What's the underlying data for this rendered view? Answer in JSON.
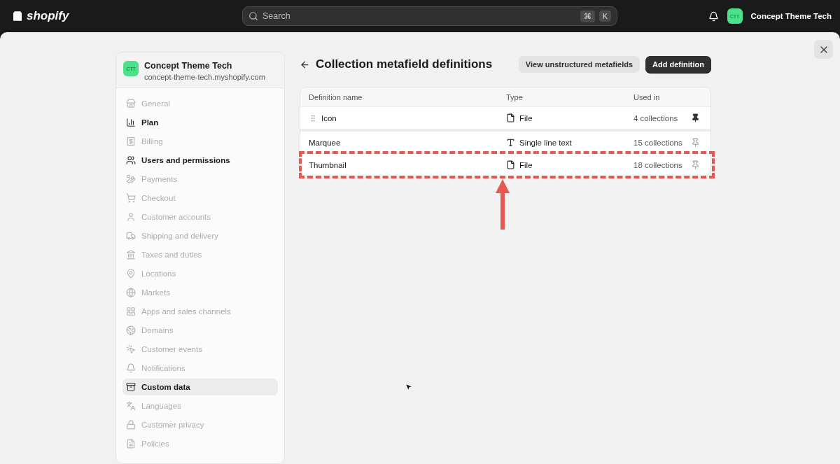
{
  "topbar": {
    "logo": "shopify",
    "search": {
      "placeholder": "Search",
      "shortcut": [
        "⌘",
        "K"
      ]
    },
    "store": {
      "initials": "CTT",
      "name": "Concept Theme Tech"
    }
  },
  "sidebar": {
    "store": {
      "initials": "CTT",
      "name": "Concept Theme Tech",
      "domain": "concept-theme-tech.myshopify.com"
    },
    "items": [
      {
        "label": "General",
        "disabled": true,
        "selected": false
      },
      {
        "label": "Plan",
        "disabled": false,
        "selected": false
      },
      {
        "label": "Billing",
        "disabled": true,
        "selected": false
      },
      {
        "label": "Users and permissions",
        "disabled": false,
        "selected": false
      },
      {
        "label": "Payments",
        "disabled": true,
        "selected": false
      },
      {
        "label": "Checkout",
        "disabled": true,
        "selected": false
      },
      {
        "label": "Customer accounts",
        "disabled": true,
        "selected": false
      },
      {
        "label": "Shipping and delivery",
        "disabled": true,
        "selected": false
      },
      {
        "label": "Taxes and duties",
        "disabled": true,
        "selected": false
      },
      {
        "label": "Locations",
        "disabled": true,
        "selected": false
      },
      {
        "label": "Markets",
        "disabled": true,
        "selected": false
      },
      {
        "label": "Apps and sales channels",
        "disabled": true,
        "selected": false
      },
      {
        "label": "Domains",
        "disabled": true,
        "selected": false
      },
      {
        "label": "Customer events",
        "disabled": true,
        "selected": false
      },
      {
        "label": "Notifications",
        "disabled": true,
        "selected": false
      },
      {
        "label": "Custom data",
        "disabled": false,
        "selected": true
      },
      {
        "label": "Languages",
        "disabled": true,
        "selected": false
      },
      {
        "label": "Customer privacy",
        "disabled": true,
        "selected": false
      },
      {
        "label": "Policies",
        "disabled": true,
        "selected": false
      }
    ]
  },
  "page": {
    "title": "Collection metafield definitions",
    "buttons": [
      {
        "label": "View unstructured metafields",
        "kind": "secondary"
      },
      {
        "label": "Add definition",
        "kind": "primary"
      }
    ]
  },
  "table": {
    "columns": [
      "Definition name",
      "Type",
      "Used in"
    ],
    "rows": [
      {
        "name": "Icon",
        "type": "File",
        "kind": "file",
        "used_in": "4 collections",
        "pinned": true,
        "highlighted": false
      },
      {
        "name": "Marquee",
        "type": "Single line text",
        "kind": "text",
        "used_in": "15 collections",
        "pinned": false,
        "highlighted": false
      },
      {
        "name": "Thumbnail",
        "type": "File",
        "kind": "file",
        "used_in": "18 collections",
        "pinned": false,
        "highlighted": true
      }
    ]
  }
}
